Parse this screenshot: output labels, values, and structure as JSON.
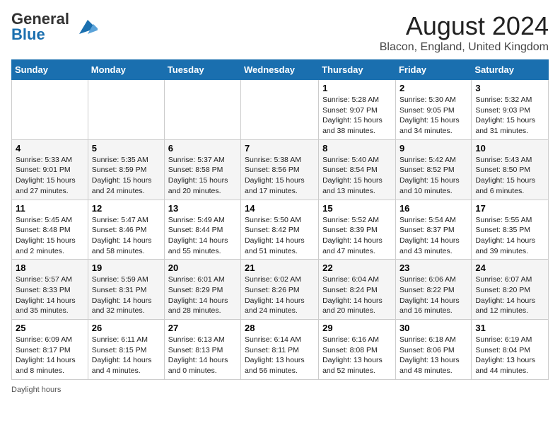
{
  "header": {
    "logo_general": "General",
    "logo_blue": "Blue",
    "month_year": "August 2024",
    "location": "Blacon, England, United Kingdom"
  },
  "days_of_week": [
    "Sunday",
    "Monday",
    "Tuesday",
    "Wednesday",
    "Thursday",
    "Friday",
    "Saturday"
  ],
  "weeks": [
    [
      {
        "day": "",
        "sunrise": "",
        "sunset": "",
        "daylight": ""
      },
      {
        "day": "",
        "sunrise": "",
        "sunset": "",
        "daylight": ""
      },
      {
        "day": "",
        "sunrise": "",
        "sunset": "",
        "daylight": ""
      },
      {
        "day": "",
        "sunrise": "",
        "sunset": "",
        "daylight": ""
      },
      {
        "day": "1",
        "sunrise": "Sunrise: 5:28 AM",
        "sunset": "Sunset: 9:07 PM",
        "daylight": "Daylight: 15 hours and 38 minutes."
      },
      {
        "day": "2",
        "sunrise": "Sunrise: 5:30 AM",
        "sunset": "Sunset: 9:05 PM",
        "daylight": "Daylight: 15 hours and 34 minutes."
      },
      {
        "day": "3",
        "sunrise": "Sunrise: 5:32 AM",
        "sunset": "Sunset: 9:03 PM",
        "daylight": "Daylight: 15 hours and 31 minutes."
      }
    ],
    [
      {
        "day": "4",
        "sunrise": "Sunrise: 5:33 AM",
        "sunset": "Sunset: 9:01 PM",
        "daylight": "Daylight: 15 hours and 27 minutes."
      },
      {
        "day": "5",
        "sunrise": "Sunrise: 5:35 AM",
        "sunset": "Sunset: 8:59 PM",
        "daylight": "Daylight: 15 hours and 24 minutes."
      },
      {
        "day": "6",
        "sunrise": "Sunrise: 5:37 AM",
        "sunset": "Sunset: 8:58 PM",
        "daylight": "Daylight: 15 hours and 20 minutes."
      },
      {
        "day": "7",
        "sunrise": "Sunrise: 5:38 AM",
        "sunset": "Sunset: 8:56 PM",
        "daylight": "Daylight: 15 hours and 17 minutes."
      },
      {
        "day": "8",
        "sunrise": "Sunrise: 5:40 AM",
        "sunset": "Sunset: 8:54 PM",
        "daylight": "Daylight: 15 hours and 13 minutes."
      },
      {
        "day": "9",
        "sunrise": "Sunrise: 5:42 AM",
        "sunset": "Sunset: 8:52 PM",
        "daylight": "Daylight: 15 hours and 10 minutes."
      },
      {
        "day": "10",
        "sunrise": "Sunrise: 5:43 AM",
        "sunset": "Sunset: 8:50 PM",
        "daylight": "Daylight: 15 hours and 6 minutes."
      }
    ],
    [
      {
        "day": "11",
        "sunrise": "Sunrise: 5:45 AM",
        "sunset": "Sunset: 8:48 PM",
        "daylight": "Daylight: 15 hours and 2 minutes."
      },
      {
        "day": "12",
        "sunrise": "Sunrise: 5:47 AM",
        "sunset": "Sunset: 8:46 PM",
        "daylight": "Daylight: 14 hours and 58 minutes."
      },
      {
        "day": "13",
        "sunrise": "Sunrise: 5:49 AM",
        "sunset": "Sunset: 8:44 PM",
        "daylight": "Daylight: 14 hours and 55 minutes."
      },
      {
        "day": "14",
        "sunrise": "Sunrise: 5:50 AM",
        "sunset": "Sunset: 8:42 PM",
        "daylight": "Daylight: 14 hours and 51 minutes."
      },
      {
        "day": "15",
        "sunrise": "Sunrise: 5:52 AM",
        "sunset": "Sunset: 8:39 PM",
        "daylight": "Daylight: 14 hours and 47 minutes."
      },
      {
        "day": "16",
        "sunrise": "Sunrise: 5:54 AM",
        "sunset": "Sunset: 8:37 PM",
        "daylight": "Daylight: 14 hours and 43 minutes."
      },
      {
        "day": "17",
        "sunrise": "Sunrise: 5:55 AM",
        "sunset": "Sunset: 8:35 PM",
        "daylight": "Daylight: 14 hours and 39 minutes."
      }
    ],
    [
      {
        "day": "18",
        "sunrise": "Sunrise: 5:57 AM",
        "sunset": "Sunset: 8:33 PM",
        "daylight": "Daylight: 14 hours and 35 minutes."
      },
      {
        "day": "19",
        "sunrise": "Sunrise: 5:59 AM",
        "sunset": "Sunset: 8:31 PM",
        "daylight": "Daylight: 14 hours and 32 minutes."
      },
      {
        "day": "20",
        "sunrise": "Sunrise: 6:01 AM",
        "sunset": "Sunset: 8:29 PM",
        "daylight": "Daylight: 14 hours and 28 minutes."
      },
      {
        "day": "21",
        "sunrise": "Sunrise: 6:02 AM",
        "sunset": "Sunset: 8:26 PM",
        "daylight": "Daylight: 14 hours and 24 minutes."
      },
      {
        "day": "22",
        "sunrise": "Sunrise: 6:04 AM",
        "sunset": "Sunset: 8:24 PM",
        "daylight": "Daylight: 14 hours and 20 minutes."
      },
      {
        "day": "23",
        "sunrise": "Sunrise: 6:06 AM",
        "sunset": "Sunset: 8:22 PM",
        "daylight": "Daylight: 14 hours and 16 minutes."
      },
      {
        "day": "24",
        "sunrise": "Sunrise: 6:07 AM",
        "sunset": "Sunset: 8:20 PM",
        "daylight": "Daylight: 14 hours and 12 minutes."
      }
    ],
    [
      {
        "day": "25",
        "sunrise": "Sunrise: 6:09 AM",
        "sunset": "Sunset: 8:17 PM",
        "daylight": "Daylight: 14 hours and 8 minutes."
      },
      {
        "day": "26",
        "sunrise": "Sunrise: 6:11 AM",
        "sunset": "Sunset: 8:15 PM",
        "daylight": "Daylight: 14 hours and 4 minutes."
      },
      {
        "day": "27",
        "sunrise": "Sunrise: 6:13 AM",
        "sunset": "Sunset: 8:13 PM",
        "daylight": "Daylight: 14 hours and 0 minutes."
      },
      {
        "day": "28",
        "sunrise": "Sunrise: 6:14 AM",
        "sunset": "Sunset: 8:11 PM",
        "daylight": "Daylight: 13 hours and 56 minutes."
      },
      {
        "day": "29",
        "sunrise": "Sunrise: 6:16 AM",
        "sunset": "Sunset: 8:08 PM",
        "daylight": "Daylight: 13 hours and 52 minutes."
      },
      {
        "day": "30",
        "sunrise": "Sunrise: 6:18 AM",
        "sunset": "Sunset: 8:06 PM",
        "daylight": "Daylight: 13 hours and 48 minutes."
      },
      {
        "day": "31",
        "sunrise": "Sunrise: 6:19 AM",
        "sunset": "Sunset: 8:04 PM",
        "daylight": "Daylight: 13 hours and 44 minutes."
      }
    ]
  ],
  "footer": {
    "daylight_label": "Daylight hours"
  }
}
